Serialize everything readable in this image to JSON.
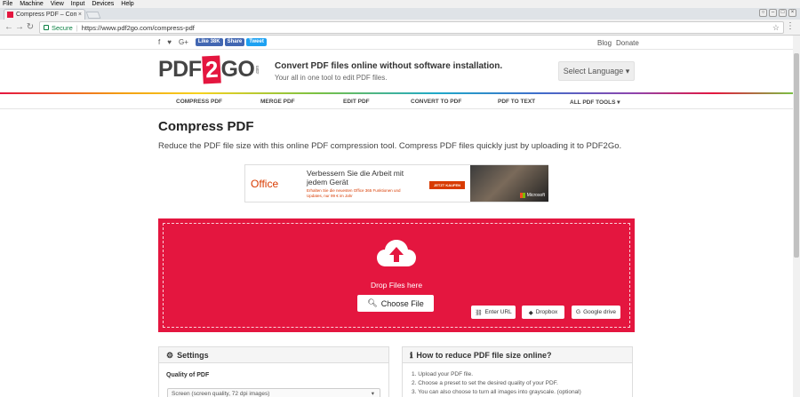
{
  "os_menu": [
    "File",
    "Machine",
    "View",
    "Input",
    "Devices",
    "Help"
  ],
  "browser": {
    "tab_title": "Compress PDF – Compre",
    "tab_close": "×",
    "secure_label": "Secure",
    "url": "https://www.pdf2go.com/compress-pdf"
  },
  "topbar": {
    "social_icons": [
      "f",
      "♥",
      "G+"
    ],
    "fb_like": "Like 38K",
    "fb_share": "Share",
    "tweet": "Tweet",
    "links": [
      "Blog",
      "Donate"
    ]
  },
  "header": {
    "logo_pdf": "PDF",
    "logo_2": "2",
    "logo_go": "GO",
    "logo_com": ".com",
    "tagline": "Convert PDF files online without software installation.",
    "subtagline": "Your all in one tool to edit PDF files.",
    "language_button": "Select Language ▾"
  },
  "nav": [
    "COMPRESS PDF",
    "MERGE PDF",
    "EDIT PDF",
    "CONVERT TO PDF",
    "PDF TO TEXT",
    "ALL PDF TOOLS ▾"
  ],
  "main": {
    "title": "Compress PDF",
    "description": "Reduce the PDF file size with this online PDF compression tool. Compress PDF files quickly just by uploading it to PDF2Go."
  },
  "ad": {
    "brand": "Office",
    "headline": "Verbessern Sie die Arbeit mit jedem Gerät",
    "small_text": "Erhalten Sie die neuesten Office 365 Funktionen und Updates, nur 99 € im Jahr",
    "cta": "JETZT KAUFEN",
    "microsoft": "Microsoft"
  },
  "dropzone": {
    "drop_text": "Drop Files here",
    "choose_file": "Choose File",
    "enter_url": "Enter URL",
    "dropbox": "Dropbox",
    "google_drive": "Google drive",
    "accent_color": "#e4163f"
  },
  "settings": {
    "title": "Settings",
    "quality_label": "Quality of PDF",
    "quality_value": "Screen (screen quality, 72 dpi images)"
  },
  "howto": {
    "title": "How to reduce PDF file size online?",
    "steps": [
      "1. Upload your PDF file.",
      "2. Choose a preset to set the desired quality of your PDF.",
      "3. You can also choose to turn all images into grayscale. (optional)"
    ]
  }
}
